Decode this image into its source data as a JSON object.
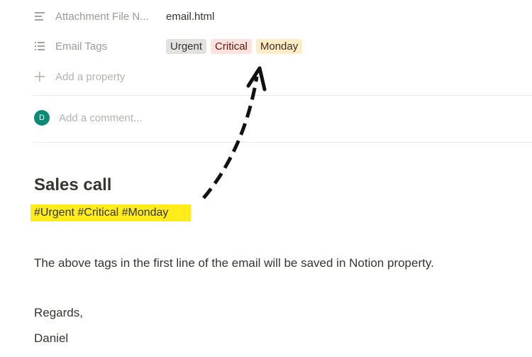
{
  "properties": [
    {
      "icon": "text-lines-icon",
      "name": "Attachment File N...",
      "value": "email.html"
    },
    {
      "icon": "list-icon",
      "name": "Email Tags",
      "tags": [
        {
          "label": "Urgent",
          "bg": "#e3e2e0",
          "color": "#37352f"
        },
        {
          "label": "Critical",
          "bg": "#ffe2dd",
          "color": "#5d1715"
        },
        {
          "label": "Monday",
          "bg": "#fdecc8",
          "color": "#402c1b"
        }
      ]
    }
  ],
  "add_property_label": "Add a property",
  "comment": {
    "avatar_initial": "D",
    "placeholder": "Add a comment..."
  },
  "content": {
    "heading": "Sales call",
    "tags_line": "#Urgent #Critical #Monday",
    "paragraph": "The above tags in the first line of the email will be saved in Notion property.",
    "regards": "Regards,",
    "signature": "Daniel"
  },
  "colors": {
    "highlight": "#ffec1a",
    "avatar": "#0b8a76",
    "arrow": "#111111"
  }
}
